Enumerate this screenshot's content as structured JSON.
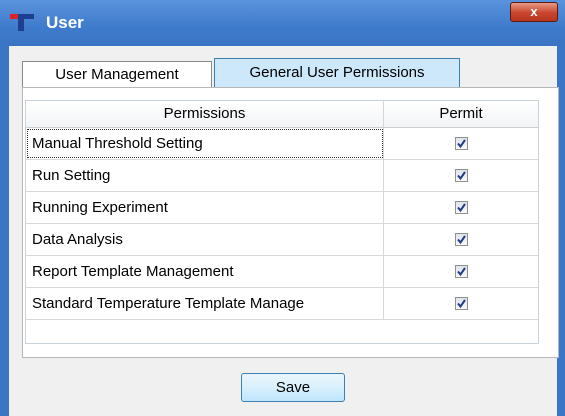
{
  "window": {
    "title": "User",
    "close_label": "x"
  },
  "tabs": [
    {
      "label": "User Management",
      "selected": false
    },
    {
      "label": "General User Permissions",
      "selected": true
    }
  ],
  "grid": {
    "headers": {
      "permissions": "Permissions",
      "permit": "Permit"
    },
    "rows": [
      {
        "name": "Manual Threshold Setting",
        "permit": true
      },
      {
        "name": "Run Setting",
        "permit": true
      },
      {
        "name": "Running Experiment",
        "permit": true
      },
      {
        "name": "Data Analysis",
        "permit": true
      },
      {
        "name": "Report Template Management",
        "permit": true
      },
      {
        "name": "Standard Temperature Template Manage",
        "permit": true
      }
    ]
  },
  "buttons": {
    "save": "Save"
  },
  "colors": {
    "title_bar": "#3f7bcc",
    "selected_tab": "#cde7fb",
    "close_button": "#c9452d"
  }
}
